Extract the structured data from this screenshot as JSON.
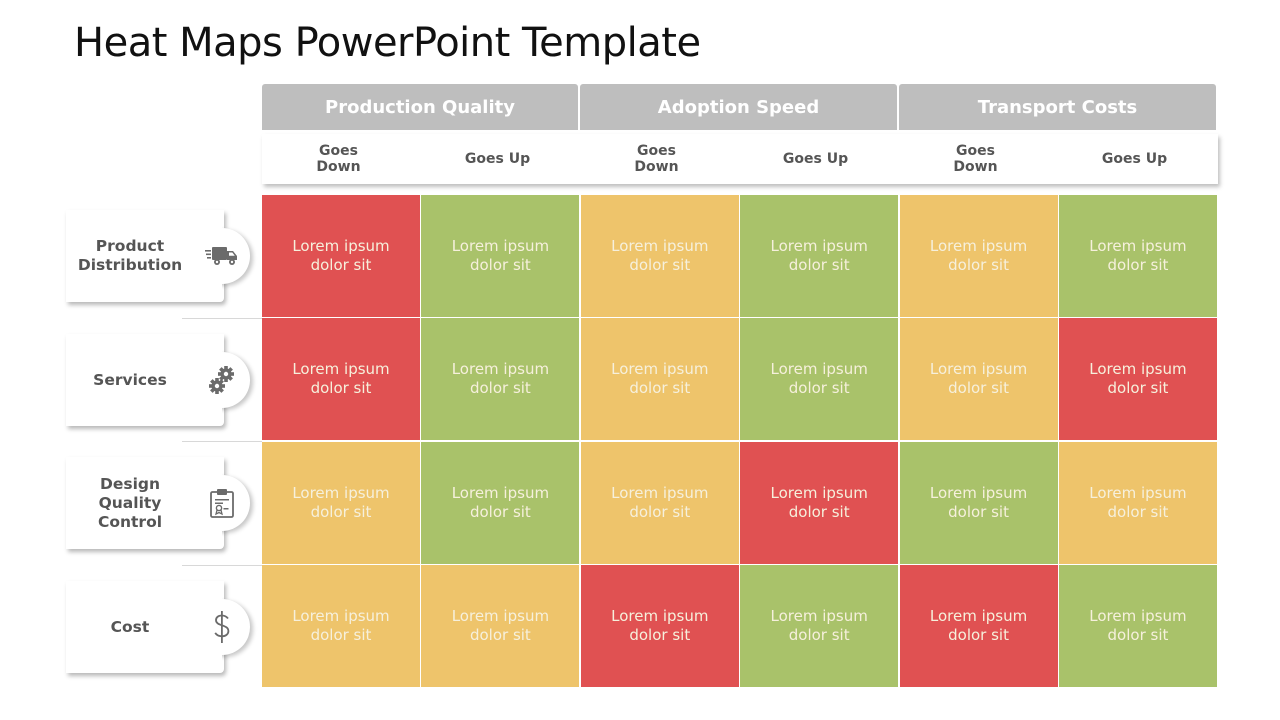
{
  "title": "Heat Maps PowerPoint Template",
  "colors": {
    "red": "#E05152",
    "green": "#A9C26A",
    "yellow": "#EEC46B",
    "header_gray": "#BEBEBE",
    "label_text": "#555555"
  },
  "column_groups": [
    {
      "label": "Production Quality"
    },
    {
      "label": "Adoption Speed"
    },
    {
      "label": "Transport Costs"
    }
  ],
  "subheaders": [
    {
      "label": "Goes\nDown"
    },
    {
      "label": "Goes Up"
    },
    {
      "label": "Goes\nDown"
    },
    {
      "label": "Goes Up"
    },
    {
      "label": "Goes\nDown"
    },
    {
      "label": "Goes Up"
    }
  ],
  "rows": [
    {
      "label": "Product Distribution",
      "icon": "truck-icon",
      "cells": [
        {
          "text": "Lorem ipsum dolor sit",
          "status": "red"
        },
        {
          "text": "Lorem ipsum dolor sit",
          "status": "green"
        },
        {
          "text": "Lorem ipsum dolor sit",
          "status": "yellow"
        },
        {
          "text": "Lorem ipsum dolor sit",
          "status": "green"
        },
        {
          "text": "Lorem ipsum dolor sit",
          "status": "yellow"
        },
        {
          "text": "Lorem ipsum dolor sit",
          "status": "green"
        }
      ]
    },
    {
      "label": "Services",
      "icon": "gears-icon",
      "cells": [
        {
          "text": "Lorem ipsum dolor sit",
          "status": "red"
        },
        {
          "text": "Lorem ipsum dolor sit",
          "status": "green"
        },
        {
          "text": "Lorem ipsum dolor sit",
          "status": "yellow"
        },
        {
          "text": "Lorem ipsum dolor sit",
          "status": "green"
        },
        {
          "text": "Lorem ipsum dolor sit",
          "status": "yellow"
        },
        {
          "text": "Lorem ipsum dolor sit",
          "status": "red"
        }
      ]
    },
    {
      "label": "Design Quality Control",
      "icon": "clipboard-certificate-icon",
      "cells": [
        {
          "text": "Lorem ipsum dolor sit",
          "status": "yellow"
        },
        {
          "text": "Lorem ipsum dolor sit",
          "status": "green"
        },
        {
          "text": "Lorem ipsum dolor sit",
          "status": "yellow"
        },
        {
          "text": "Lorem ipsum dolor sit",
          "status": "red"
        },
        {
          "text": "Lorem ipsum dolor sit",
          "status": "green"
        },
        {
          "text": "Lorem ipsum dolor sit",
          "status": "yellow"
        }
      ]
    },
    {
      "label": "Cost",
      "icon": "dollar-icon",
      "cells": [
        {
          "text": "Lorem ipsum dolor sit",
          "status": "yellow"
        },
        {
          "text": "Lorem ipsum dolor sit",
          "status": "yellow"
        },
        {
          "text": "Lorem ipsum dolor sit",
          "status": "red"
        },
        {
          "text": "Lorem ipsum dolor sit",
          "status": "green"
        },
        {
          "text": "Lorem ipsum dolor sit",
          "status": "red"
        },
        {
          "text": "Lorem ipsum dolor sit",
          "status": "green"
        }
      ]
    }
  ]
}
